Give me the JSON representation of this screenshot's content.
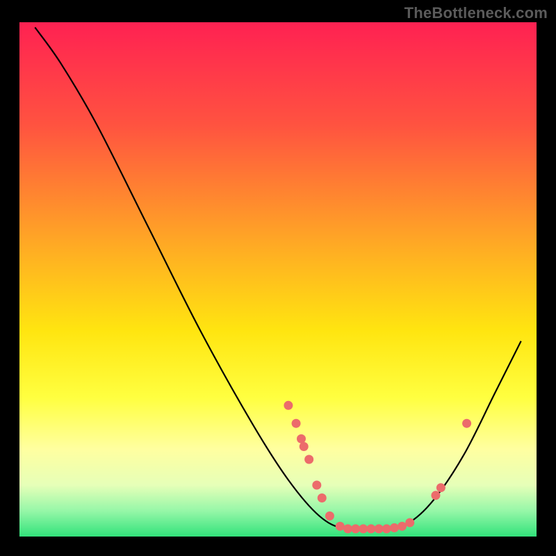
{
  "watermark": "TheBottleneck.com",
  "colors": {
    "black": "#000000",
    "marker": "#EC6B6B",
    "curve": "#000000"
  },
  "chart_data": {
    "type": "line",
    "title": "",
    "xlabel": "",
    "ylabel": "",
    "xlim": [
      0,
      100
    ],
    "ylim": [
      0,
      100
    ],
    "grid": false,
    "legend": false,
    "background_gradient": {
      "stops": [
        {
          "offset": 0.0,
          "color": "#FF2152"
        },
        {
          "offset": 0.2,
          "color": "#FF5340"
        },
        {
          "offset": 0.45,
          "color": "#FFB022"
        },
        {
          "offset": 0.6,
          "color": "#FFE510"
        },
        {
          "offset": 0.73,
          "color": "#FFFF40"
        },
        {
          "offset": 0.83,
          "color": "#FFFFA0"
        },
        {
          "offset": 0.9,
          "color": "#E6FFB8"
        },
        {
          "offset": 0.95,
          "color": "#96F7A8"
        },
        {
          "offset": 1.0,
          "color": "#32E27B"
        }
      ]
    },
    "series": [
      {
        "name": "bottleneck-curve",
        "type": "line",
        "points": [
          {
            "x": 3.0,
            "y": 99.0
          },
          {
            "x": 8.0,
            "y": 92.0
          },
          {
            "x": 15.0,
            "y": 80.0
          },
          {
            "x": 25.0,
            "y": 60.0
          },
          {
            "x": 35.0,
            "y": 40.0
          },
          {
            "x": 45.0,
            "y": 22.0
          },
          {
            "x": 52.0,
            "y": 11.0
          },
          {
            "x": 58.0,
            "y": 4.0
          },
          {
            "x": 63.0,
            "y": 1.5
          },
          {
            "x": 70.0,
            "y": 1.5
          },
          {
            "x": 75.0,
            "y": 2.5
          },
          {
            "x": 80.0,
            "y": 7.0
          },
          {
            "x": 86.0,
            "y": 16.0
          },
          {
            "x": 92.0,
            "y": 28.0
          },
          {
            "x": 97.0,
            "y": 38.0
          }
        ]
      },
      {
        "name": "markers",
        "type": "scatter",
        "points": [
          {
            "x": 52.0,
            "y": 25.5
          },
          {
            "x": 53.5,
            "y": 22.0
          },
          {
            "x": 54.5,
            "y": 19.0
          },
          {
            "x": 55.0,
            "y": 17.5
          },
          {
            "x": 56.0,
            "y": 15.0
          },
          {
            "x": 57.5,
            "y": 10.0
          },
          {
            "x": 58.5,
            "y": 7.5
          },
          {
            "x": 60.0,
            "y": 4.0
          },
          {
            "x": 62.0,
            "y": 2.0
          },
          {
            "x": 63.5,
            "y": 1.5
          },
          {
            "x": 65.0,
            "y": 1.5
          },
          {
            "x": 66.5,
            "y": 1.5
          },
          {
            "x": 68.0,
            "y": 1.5
          },
          {
            "x": 69.5,
            "y": 1.5
          },
          {
            "x": 71.0,
            "y": 1.5
          },
          {
            "x": 72.5,
            "y": 1.7
          },
          {
            "x": 74.0,
            "y": 2.0
          },
          {
            "x": 75.5,
            "y": 2.7
          },
          {
            "x": 80.5,
            "y": 8.0
          },
          {
            "x": 81.5,
            "y": 9.5
          },
          {
            "x": 86.5,
            "y": 22.0
          }
        ]
      }
    ]
  }
}
